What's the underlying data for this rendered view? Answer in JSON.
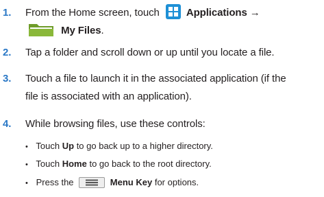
{
  "steps": [
    {
      "number": "1.",
      "line1_prefix": "From the Home screen, touch",
      "apps_label": "Applications",
      "arrow": "→",
      "myfiles_label": "My Files",
      "period": "."
    },
    {
      "number": "2.",
      "text": "Tap a folder and scroll down or up until you locate a file."
    },
    {
      "number": "3.",
      "line1": "Touch a file to launch it in the associated application (if the",
      "line2": "file is associated with an application)."
    },
    {
      "number": "4.",
      "text": "While browsing files, use these controls:"
    }
  ],
  "controls": [
    {
      "prefix": "Touch",
      "bold": "Up",
      "suffix": "to go back up to a higher directory."
    },
    {
      "prefix": "Touch",
      "bold": "Home",
      "suffix": "to go back to the root directory."
    },
    {
      "prefix": "Press the",
      "bold": "Menu Key",
      "suffix": "for options."
    }
  ],
  "bullet": "•",
  "icons": {
    "applications": "applications-grid-icon",
    "myfiles": "folder-icon",
    "menukey": "menu-key-icon"
  },
  "colors": {
    "step_number": "#2a78c6",
    "apps_icon": "#1e90d6",
    "folder_body": "#8ab83a",
    "text": "#231f20"
  }
}
